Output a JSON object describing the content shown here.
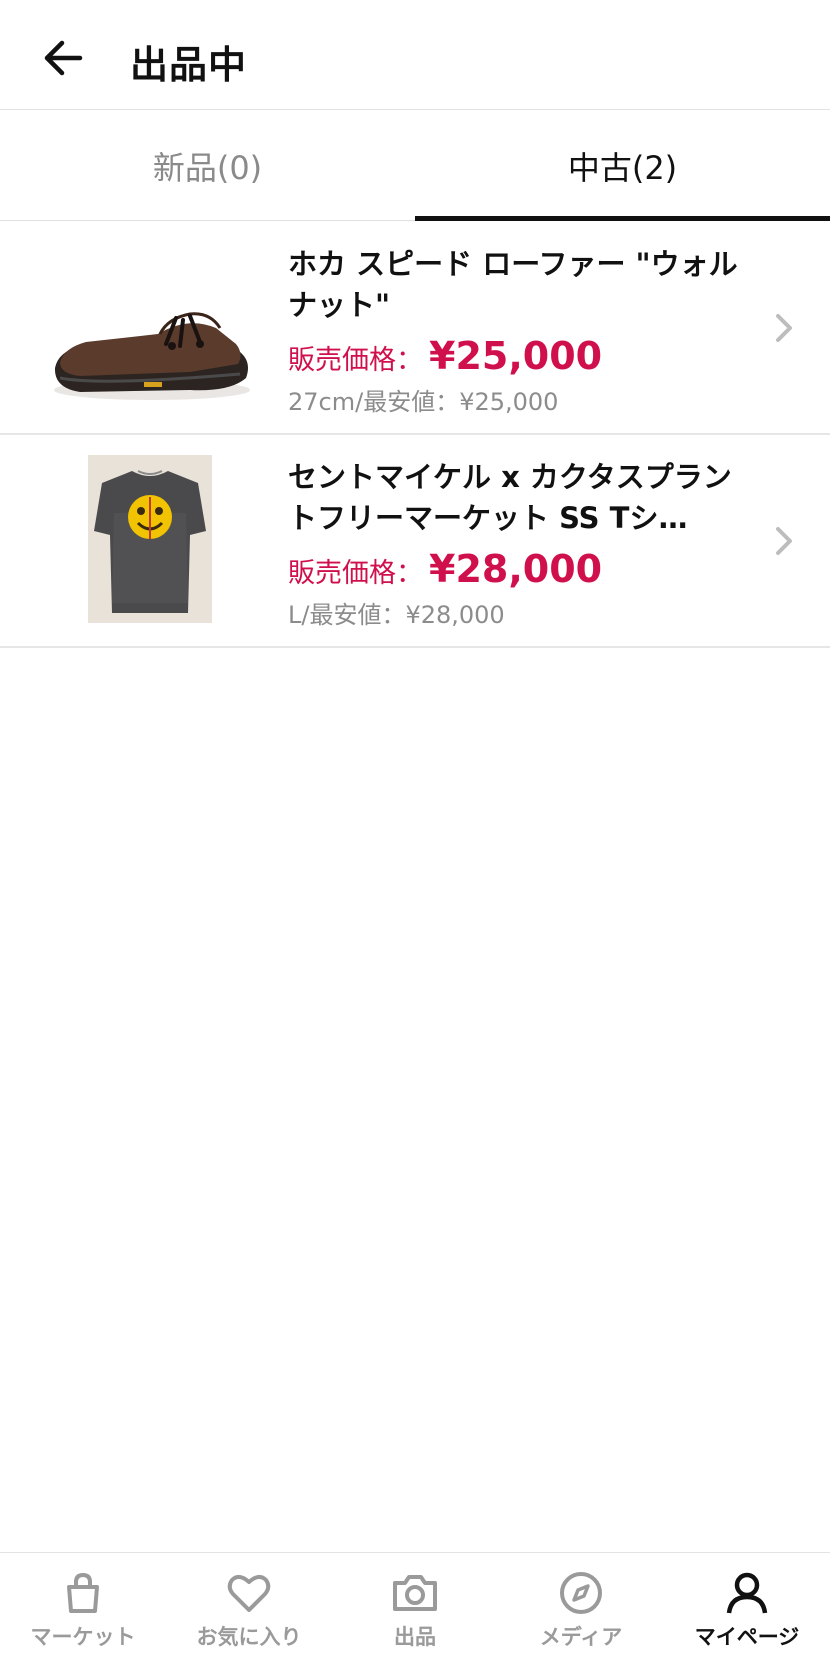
{
  "header": {
    "title": "出品中"
  },
  "tabs": [
    {
      "label": "新品(0)",
      "active": false
    },
    {
      "label": "中古(2)",
      "active": true
    }
  ],
  "items": [
    {
      "name": "ホカ スピード ローファー \"ウォルナット\"",
      "price_label": "販売価格：",
      "price": "¥25,000",
      "sub": "27cm/最安値：¥25,000",
      "image": "brown-loafer-shoe"
    },
    {
      "name": "セントマイケル x カクタスプラントフリーマーケット SS Tシ…",
      "price_label": "販売価格：",
      "price": "¥28,000",
      "sub": "L/最安値：¥28,000",
      "image": "grey-tshirt-yellow-smiley"
    }
  ],
  "bottom_nav": [
    {
      "label": "マーケット",
      "icon": "bag-icon",
      "active": false
    },
    {
      "label": "お気に入り",
      "icon": "heart-icon",
      "active": false
    },
    {
      "label": "出品",
      "icon": "camera-icon",
      "active": false
    },
    {
      "label": "メディア",
      "icon": "compass-icon",
      "active": false
    },
    {
      "label": "マイページ",
      "icon": "user-icon",
      "active": true
    }
  ],
  "colors": {
    "accent": "#d0104c",
    "muted": "#8c8c8c",
    "active_tab": "#111111"
  }
}
